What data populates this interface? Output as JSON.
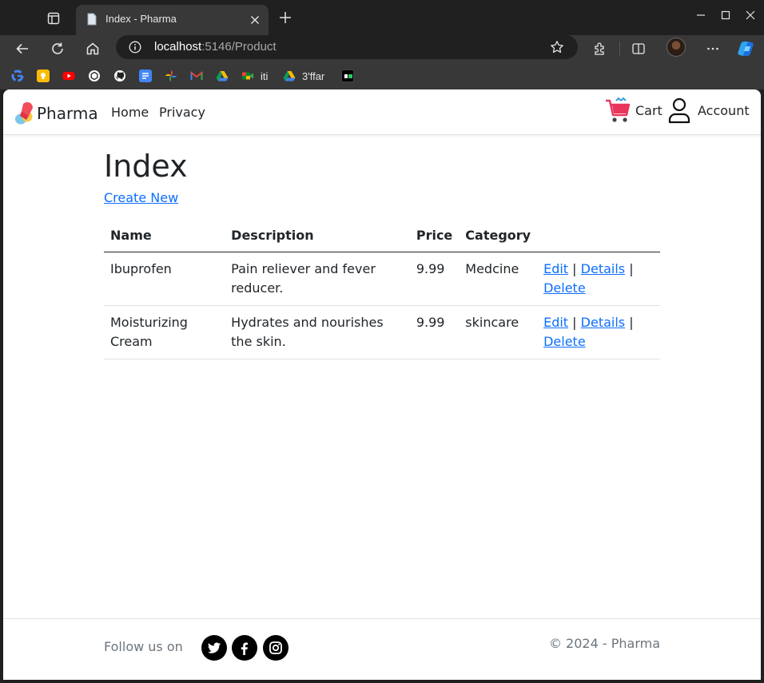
{
  "browser": {
    "tab_title": "Index - Pharma",
    "address_host": "localhost",
    "address_rest": ":5146/Product",
    "bookmarks": [
      {
        "icon": "google-icon",
        "label": ""
      },
      {
        "icon": "keep-icon",
        "label": ""
      },
      {
        "icon": "youtube-icon",
        "label": ""
      },
      {
        "icon": "chatgpt-icon",
        "label": ""
      },
      {
        "icon": "github-icon",
        "label": ""
      },
      {
        "icon": "docs-icon",
        "label": ""
      },
      {
        "icon": "photos-icon",
        "label": ""
      },
      {
        "icon": "gmail-icon",
        "label": ""
      },
      {
        "icon": "drive-icon",
        "label": ""
      },
      {
        "icon": "meet-icon",
        "label": ""
      },
      {
        "icon": "drive-iti-icon",
        "label": "iti"
      },
      {
        "icon": "drive-3ffar-icon",
        "label": "3'ffar"
      },
      {
        "icon": "hackerrank-icon",
        "label": ""
      }
    ]
  },
  "site": {
    "brand": "Pharma",
    "nav": {
      "home": "Home",
      "privacy": "Privacy",
      "cart": "Cart",
      "account": "Account"
    }
  },
  "page": {
    "title": "Index",
    "create_link": "Create New",
    "columns": [
      "Name",
      "Description",
      "Price",
      "Category"
    ],
    "rows": [
      {
        "name": "Ibuprofen",
        "description": "Pain reliever and fever reducer.",
        "price": "9.99",
        "category": "Medcine"
      },
      {
        "name": "Moisturizing Cream",
        "description": "Hydrates and nourishes the skin.",
        "price": "9.99",
        "category": "skincare"
      }
    ],
    "actions": {
      "edit": "Edit",
      "details": "Details",
      "delete": "Delete",
      "separator": "|"
    }
  },
  "footer": {
    "follow": "Follow us on",
    "social": [
      "twitter-icon",
      "facebook-icon",
      "instagram-icon"
    ],
    "copyright": "© 2024 - Pharma"
  },
  "colors": {
    "link": "#0d6efd",
    "text": "#212529",
    "muted": "#6c757d",
    "chrome_dark": "#202020",
    "chrome": "#383838"
  }
}
